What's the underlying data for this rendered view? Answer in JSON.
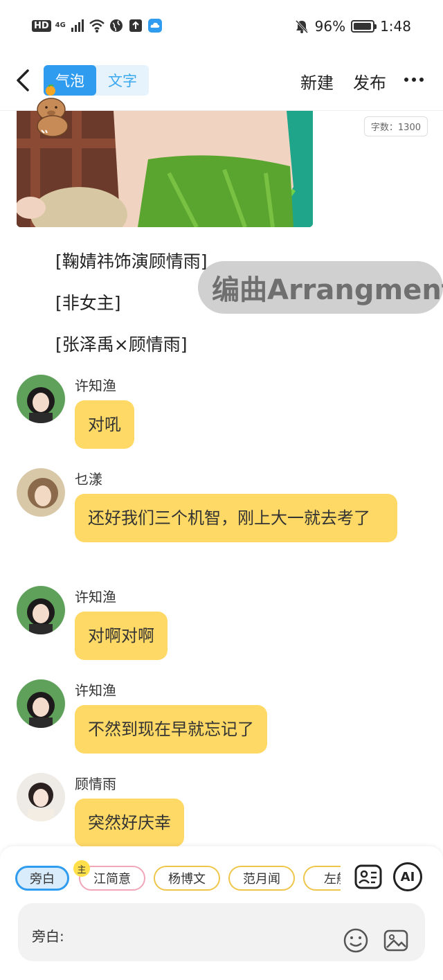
{
  "status_bar": {
    "hd": "HD",
    "network": "4G",
    "battery": "96%",
    "battery_level": 0.96,
    "time": "1:48"
  },
  "header": {
    "mode_bubble": "气泡",
    "mode_text": "文字",
    "new_label": "新建",
    "publish_label": "发布"
  },
  "word_count": "字数：1300",
  "tags": [
    "[鞠婧祎饰演顾情雨]",
    "[非女主]",
    "[张泽禹×顾情雨]"
  ],
  "watermark": "编曲Arrangment",
  "messages": [
    {
      "sender": "许知渔",
      "text": "对吼"
    },
    {
      "sender": "乜漾",
      "text": "还好我们三个机智，刚上大一就去考了"
    },
    {
      "sender": "许知渔",
      "text": "对啊对啊"
    },
    {
      "sender": "许知渔",
      "text": "不然到现在早就忘记了"
    },
    {
      "sender": "顾情雨",
      "text": "突然好庆幸"
    }
  ],
  "roles": [
    "旁白",
    "江简意",
    "杨博文",
    "范月闻",
    "左航"
  ],
  "main_badge": "主",
  "ai_label": "AI",
  "input_label": "旁白:"
}
